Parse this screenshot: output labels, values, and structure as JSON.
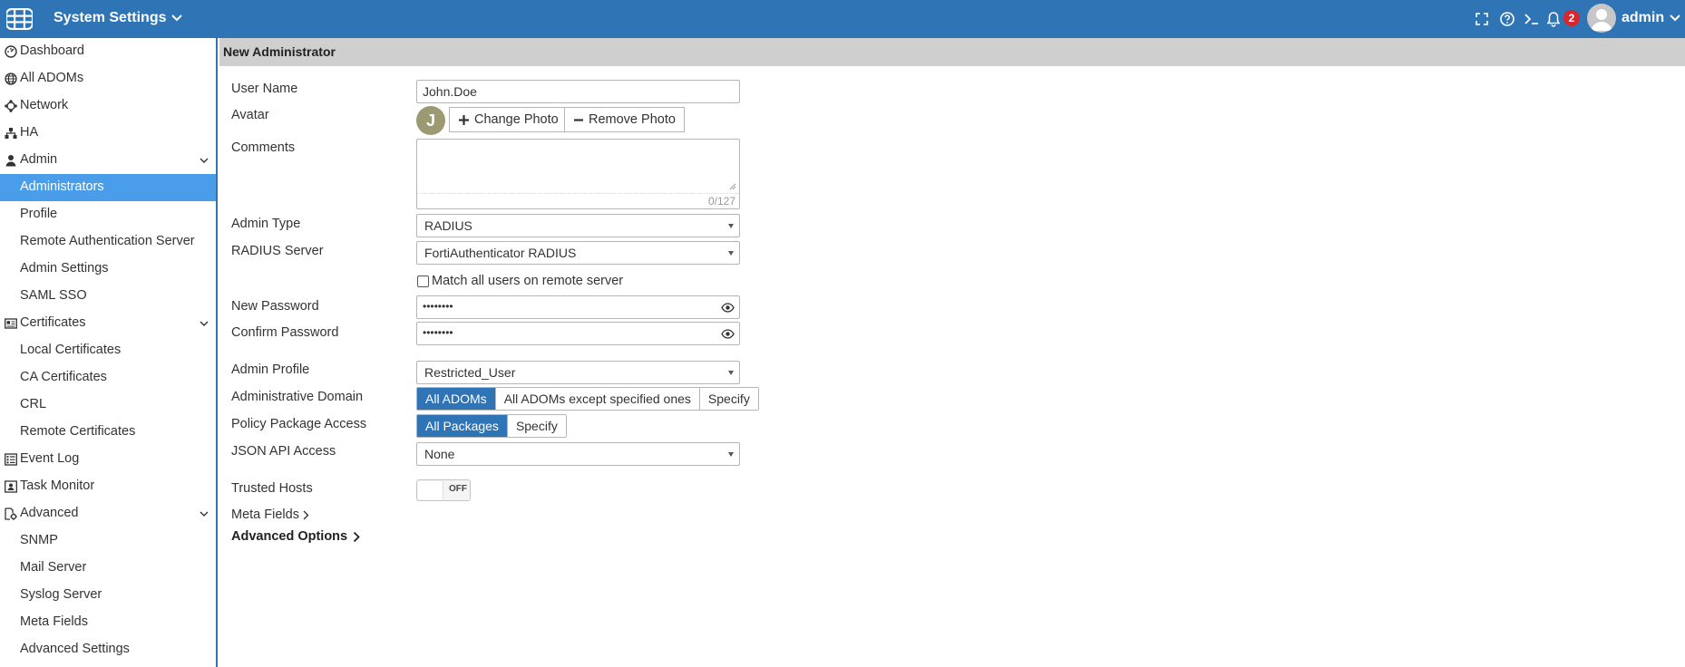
{
  "topbar": {
    "title": "System Settings",
    "notification_count": "2",
    "username": "admin",
    "icons": [
      "fullscreen-icon",
      "help-icon",
      "cli-console-icon",
      "bell-icon"
    ]
  },
  "sidebar": {
    "items": [
      {
        "label": "Dashboard",
        "icon": "dashboard-icon"
      },
      {
        "label": "All ADOMs",
        "icon": "globe-icon"
      },
      {
        "label": "Network",
        "icon": "network-icon"
      },
      {
        "label": "HA",
        "icon": "ha-icon"
      },
      {
        "label": "Admin",
        "icon": "user-icon",
        "expandable": true
      },
      {
        "label": "Administrators",
        "active": true
      },
      {
        "label": "Profile"
      },
      {
        "label": "Remote Authentication Server"
      },
      {
        "label": "Admin Settings"
      },
      {
        "label": "SAML SSO"
      },
      {
        "label": "Certificates",
        "icon": "certificate-icon",
        "expandable": true
      },
      {
        "label": "Local Certificates"
      },
      {
        "label": "CA Certificates"
      },
      {
        "label": "CRL"
      },
      {
        "label": "Remote Certificates"
      },
      {
        "label": "Event Log",
        "icon": "event-log-icon"
      },
      {
        "label": "Task Monitor",
        "icon": "task-monitor-icon"
      },
      {
        "label": "Advanced",
        "icon": "advanced-icon",
        "expandable": true
      },
      {
        "label": "SNMP"
      },
      {
        "label": "Mail Server"
      },
      {
        "label": "Syslog Server"
      },
      {
        "label": "Meta Fields"
      },
      {
        "label": "Advanced Settings"
      }
    ]
  },
  "form": {
    "header": "New Administrator",
    "user_name": {
      "label": "User Name",
      "value": "John.Doe"
    },
    "avatar": {
      "label": "Avatar",
      "initial": "J",
      "change_label": "Change Photo",
      "remove_label": "Remove Photo"
    },
    "comments": {
      "label": "Comments",
      "value": "",
      "counter": "0/127"
    },
    "admin_type": {
      "label": "Admin Type",
      "value": "RADIUS"
    },
    "radius_server": {
      "label": "RADIUS Server",
      "value": "FortiAuthenticator RADIUS"
    },
    "match_all": {
      "label": "Match all users on remote server",
      "checked": false
    },
    "new_password": {
      "label": "New Password",
      "value": "••••••••"
    },
    "confirm_password": {
      "label": "Confirm Password",
      "value": "••••••••"
    },
    "admin_profile": {
      "label": "Admin Profile",
      "value": "Restricted_User"
    },
    "admin_domain": {
      "label": "Administrative Domain",
      "options": [
        "All ADOMs",
        "All ADOMs except specified ones",
        "Specify"
      ],
      "selected": "All ADOMs"
    },
    "policy_package": {
      "label": "Policy Package Access",
      "options": [
        "All Packages",
        "Specify"
      ],
      "selected": "All Packages"
    },
    "json_api": {
      "label": "JSON API Access",
      "value": "None"
    },
    "trusted_hosts": {
      "label": "Trusted Hosts",
      "toggle_text": "OFF",
      "on": false
    },
    "meta_fields": {
      "label": "Meta Fields"
    },
    "advanced_options": {
      "label": "Advanced Options"
    }
  },
  "colors": {
    "topbar": "#2f74b5",
    "active_nav": "#4a9de8",
    "accent": "#2f74b5",
    "badge": "#d8262c"
  }
}
